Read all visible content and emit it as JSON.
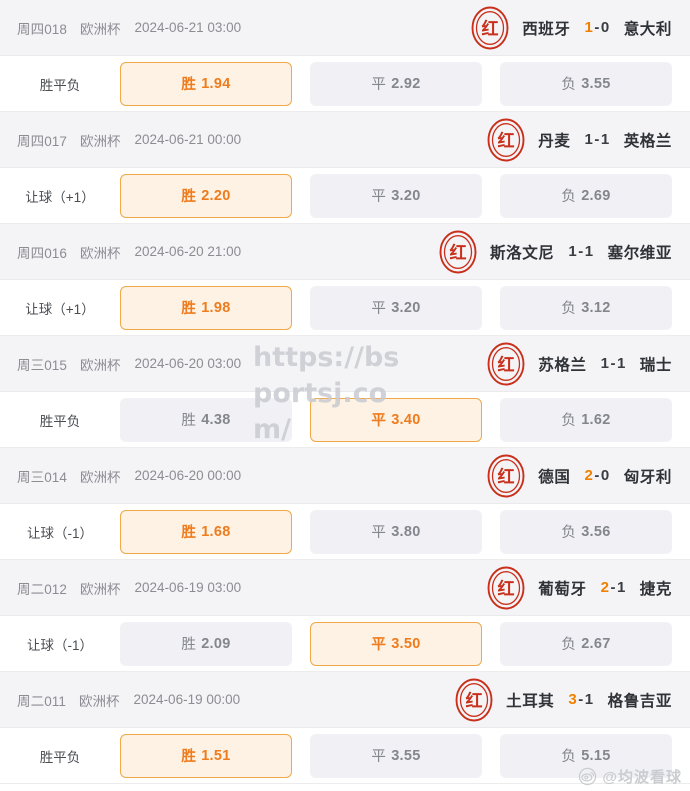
{
  "brand": {
    "accent_orange": "#ee7c1e",
    "seal_red": "#c9301c",
    "header_bg": "#f4f4f7",
    "cell_bg": "#f1f1f5",
    "hit_bg": "#fdf2e4",
    "hit_border": "#f0a848"
  },
  "watermarks": {
    "url": "https://bsportsj.com/",
    "weibo_handle": "@均波看球",
    "weibo_icon": "weibo-eye-icon"
  },
  "seal": {
    "icon": "red-seal-stamp-icon",
    "glyph": "红"
  },
  "matches": [
    {
      "round": "周四018",
      "league": "欧洲杯",
      "kickoff": "2024-06-21 03:00",
      "home": "西班牙",
      "away": "意大利",
      "score_home": "1",
      "score_sep": "-",
      "score_away": "0",
      "home_won": true,
      "away_won": false,
      "market_label": "胜平负",
      "cells": [
        {
          "key": "胜",
          "value": "1.94",
          "hit": true
        },
        {
          "key": "平",
          "value": "2.92",
          "hit": false
        },
        {
          "key": "负",
          "value": "3.55",
          "hit": false
        }
      ]
    },
    {
      "round": "周四017",
      "league": "欧洲杯",
      "kickoff": "2024-06-21 00:00",
      "home": "丹麦",
      "away": "英格兰",
      "score_home": "1",
      "score_sep": "-",
      "score_away": "1",
      "home_won": false,
      "away_won": false,
      "market_label": "让球（+1）",
      "cells": [
        {
          "key": "胜",
          "value": "2.20",
          "hit": true
        },
        {
          "key": "平",
          "value": "3.20",
          "hit": false
        },
        {
          "key": "负",
          "value": "2.69",
          "hit": false
        }
      ]
    },
    {
      "round": "周四016",
      "league": "欧洲杯",
      "kickoff": "2024-06-20 21:00",
      "home": "斯洛文尼",
      "away": "塞尔维亚",
      "score_home": "1",
      "score_sep": "-",
      "score_away": "1",
      "home_won": false,
      "away_won": false,
      "market_label": "让球（+1）",
      "cells": [
        {
          "key": "胜",
          "value": "1.98",
          "hit": true
        },
        {
          "key": "平",
          "value": "3.20",
          "hit": false
        },
        {
          "key": "负",
          "value": "3.12",
          "hit": false
        }
      ]
    },
    {
      "round": "周三015",
      "league": "欧洲杯",
      "kickoff": "2024-06-20 03:00",
      "home": "苏格兰",
      "away": "瑞士",
      "score_home": "1",
      "score_sep": "-",
      "score_away": "1",
      "home_won": false,
      "away_won": false,
      "market_label": "胜平负",
      "cells": [
        {
          "key": "胜",
          "value": "4.38",
          "hit": false
        },
        {
          "key": "平",
          "value": "3.40",
          "hit": true
        },
        {
          "key": "负",
          "value": "1.62",
          "hit": false
        }
      ]
    },
    {
      "round": "周三014",
      "league": "欧洲杯",
      "kickoff": "2024-06-20 00:00",
      "home": "德国",
      "away": "匈牙利",
      "score_home": "2",
      "score_sep": "-",
      "score_away": "0",
      "home_won": true,
      "away_won": false,
      "market_label": "让球（-1）",
      "cells": [
        {
          "key": "胜",
          "value": "1.68",
          "hit": true
        },
        {
          "key": "平",
          "value": "3.80",
          "hit": false
        },
        {
          "key": "负",
          "value": "3.56",
          "hit": false
        }
      ]
    },
    {
      "round": "周二012",
      "league": "欧洲杯",
      "kickoff": "2024-06-19 03:00",
      "home": "葡萄牙",
      "away": "捷克",
      "score_home": "2",
      "score_sep": "-",
      "score_away": "1",
      "home_won": true,
      "away_won": false,
      "market_label": "让球（-1）",
      "cells": [
        {
          "key": "胜",
          "value": "2.09",
          "hit": false
        },
        {
          "key": "平",
          "value": "3.50",
          "hit": true
        },
        {
          "key": "负",
          "value": "2.67",
          "hit": false
        }
      ]
    },
    {
      "round": "周二011",
      "league": "欧洲杯",
      "kickoff": "2024-06-19 00:00",
      "home": "土耳其",
      "away": "格鲁吉亚",
      "score_home": "3",
      "score_sep": "-",
      "score_away": "1",
      "home_won": true,
      "away_won": false,
      "market_label": "胜平负",
      "cells": [
        {
          "key": "胜",
          "value": "1.51",
          "hit": true
        },
        {
          "key": "平",
          "value": "3.55",
          "hit": false
        },
        {
          "key": "负",
          "value": "5.15",
          "hit": false
        }
      ]
    }
  ]
}
